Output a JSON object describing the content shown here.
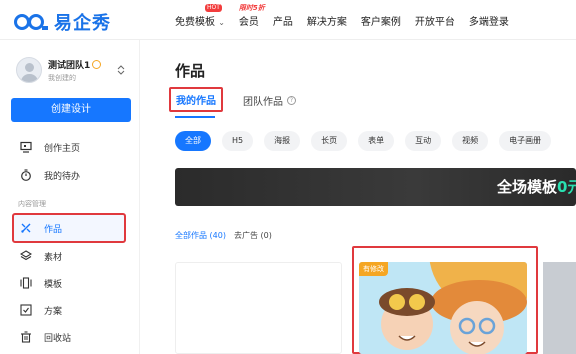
{
  "brand": {
    "name": "易企秀"
  },
  "nav": {
    "items": [
      {
        "label": "免费模板",
        "badge": "HOT",
        "caret": "⌄"
      },
      {
        "label": "会员",
        "promo": "限时5折"
      },
      {
        "label": "产品"
      },
      {
        "label": "解决方案"
      },
      {
        "label": "客户案例"
      },
      {
        "label": "开放平台"
      },
      {
        "label": "多端登录"
      }
    ]
  },
  "sidebar": {
    "team_name": "测试团队1",
    "team_sub": "我创建的",
    "switch_icon": "⌃⌄",
    "create_button": "创建设计",
    "items": [
      {
        "label": "创作主页",
        "icon": "monitor-icon"
      },
      {
        "label": "我的待办",
        "icon": "timer-icon"
      }
    ],
    "group_label": "内容管理",
    "content_items": [
      {
        "label": "作品",
        "icon": "works-icon",
        "active": true
      },
      {
        "label": "素材",
        "icon": "layers-icon"
      },
      {
        "label": "模板",
        "icon": "template-icon"
      },
      {
        "label": "方案",
        "icon": "checkbox-icon"
      },
      {
        "label": "回收站",
        "icon": "trash-icon"
      }
    ]
  },
  "main": {
    "title": "作品",
    "tabs": [
      {
        "label": "我的作品",
        "active": true
      },
      {
        "label": "团队作品",
        "help": "?"
      }
    ],
    "filters": [
      "全部",
      "H5",
      "海报",
      "长页",
      "表单",
      "互动",
      "视频",
      "电子画册"
    ],
    "banner_text_a": "全场模板",
    "banner_text_b": "0元",
    "counts": {
      "all": "全部作品 (40)",
      "ads": "去广告 (0)"
    },
    "card_tag": "有修改"
  },
  "colors": {
    "primary": "#1677ff",
    "highlight_border": "#e0393e",
    "banner_accent": "#29e0b0"
  }
}
